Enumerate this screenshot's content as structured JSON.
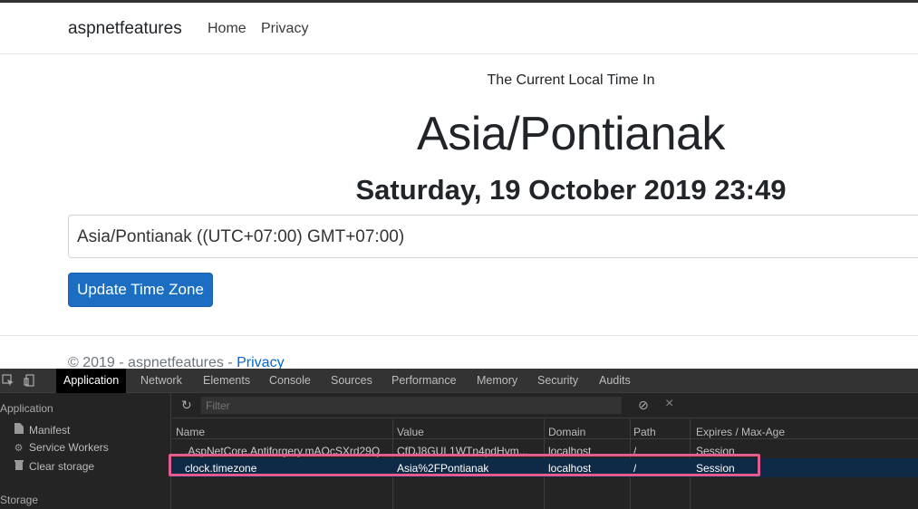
{
  "navbar": {
    "brand": "aspnetfeatures",
    "links": [
      {
        "label": "Home"
      },
      {
        "label": "Privacy"
      }
    ]
  },
  "main": {
    "subtitle": "The Current Local Time In",
    "zone_title": "Asia/Pontianak",
    "datetime": "Saturday, 19 October 2019 23:49",
    "timezone_select_value": "Asia/Pontianak ((UTC+07:00) GMT+07:00)",
    "update_button_label": "Update Time Zone"
  },
  "footer": {
    "text": "© 2019 - aspnetfeatures - ",
    "link": "Privacy"
  },
  "devtools": {
    "tabs": [
      "Application",
      "Network",
      "Elements",
      "Console",
      "Sources",
      "Performance",
      "Memory",
      "Security",
      "Audits"
    ],
    "active_tab": "Application",
    "sidebar": {
      "application_heading": "Application",
      "items": [
        {
          "label": "Manifest",
          "icon": "file-icon"
        },
        {
          "label": "Service Workers",
          "icon": "gear-icon"
        },
        {
          "label": "Clear storage",
          "icon": "trash-icon"
        }
      ],
      "storage_heading": "Storage"
    },
    "filter_placeholder": "Filter",
    "cookie_table": {
      "columns": [
        "Name",
        "Value",
        "Domain",
        "Path",
        "Expires / Max-Age"
      ],
      "rows": [
        {
          "name": ".AspNetCore.Antiforgery.mAOcSXrd29Q",
          "value": "CfDJ8GUL1WTn4pdHvm...",
          "domain": "localhost",
          "path": "/",
          "expires": "Session"
        },
        {
          "name": "clock.timezone",
          "value": "Asia%2FPontianak",
          "domain": "localhost",
          "path": "/",
          "expires": "Session"
        }
      ],
      "selected_row": 1
    },
    "highlight_color": "#e45c8e"
  }
}
